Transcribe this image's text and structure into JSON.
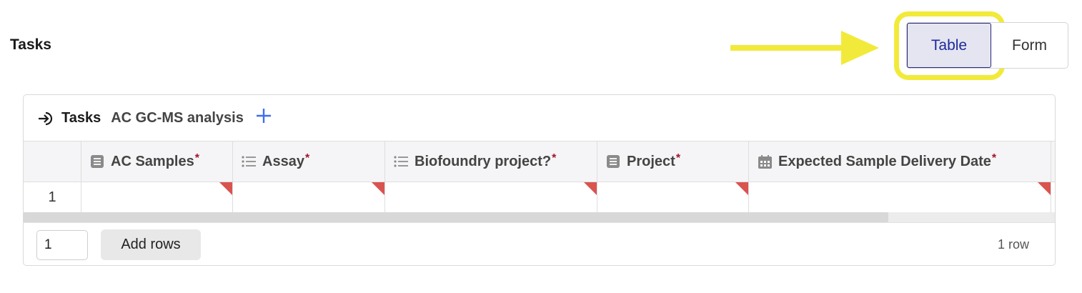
{
  "section": {
    "title": "Tasks"
  },
  "view_toggle": {
    "options": [
      {
        "label": "Table",
        "selected": true
      },
      {
        "label": "Form",
        "selected": false
      }
    ]
  },
  "annotation": {
    "arrow_color": "#f2ea3a",
    "highlight_color": "#f2ea3a"
  },
  "panel": {
    "title": "Tasks",
    "subtitle": "AC GC-MS analysis",
    "add_icon": "plus-icon",
    "title_icon": "sign-in-arrow-icon"
  },
  "table": {
    "columns": [
      {
        "label": "AC Samples",
        "required_mark": "*",
        "icon": "list-box-icon"
      },
      {
        "label": "Assay",
        "required_mark": "*",
        "icon": "bullet-list-icon"
      },
      {
        "label": "Biofoundry project?",
        "required_mark": "*",
        "icon": "bullet-list-icon"
      },
      {
        "label": "Project",
        "required_mark": "*",
        "icon": "list-box-icon"
      },
      {
        "label": "Expected Sample Delivery Date",
        "required_mark": "*",
        "icon": "calendar-icon"
      }
    ],
    "rows": [
      {
        "number": "1",
        "cells": [
          "",
          "",
          "",
          "",
          ""
        ]
      }
    ]
  },
  "footer": {
    "rows_input_value": "1",
    "add_rows_label": "Add rows",
    "row_count": "1 row"
  }
}
